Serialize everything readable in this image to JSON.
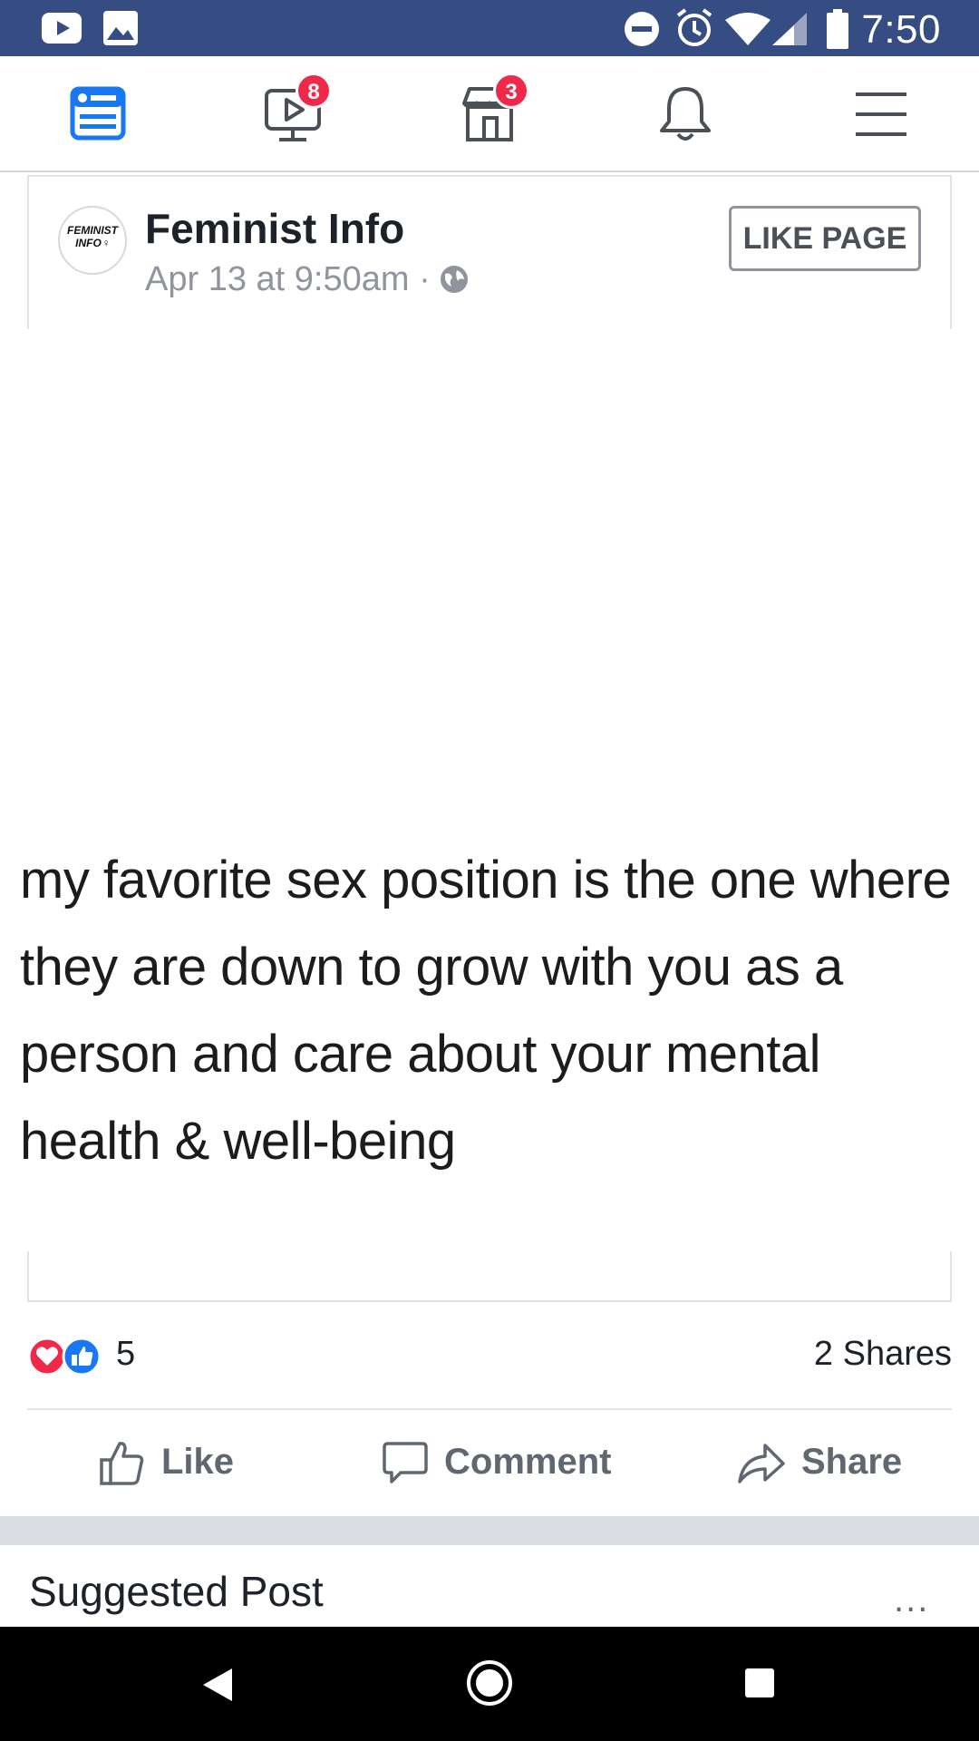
{
  "status_bar": {
    "time": "7:50"
  },
  "nav": {
    "video_badge": "8",
    "marketplace_badge": "3"
  },
  "post": {
    "page_name": "Feminist Info",
    "avatar_text_line1": "FEMINIST",
    "avatar_text_line2": "INFO",
    "timestamp": "Apr 13 at 9:50am",
    "separator": "·",
    "like_page_label": "LIKE PAGE",
    "image_text": "my favorite sex position is the one where they are down to grow with you as a person and care about your mental health & well-being",
    "reaction_count": "5",
    "shares": "2 Shares"
  },
  "actions": {
    "like": "Like",
    "comment": "Comment",
    "share": "Share"
  },
  "suggested": {
    "title": "Suggested Post",
    "more": "..."
  },
  "colors": {
    "status_bar": "#354d83",
    "brand_blue": "#1877f2",
    "badge_red": "#f02849",
    "love_red": "#f0284a"
  }
}
